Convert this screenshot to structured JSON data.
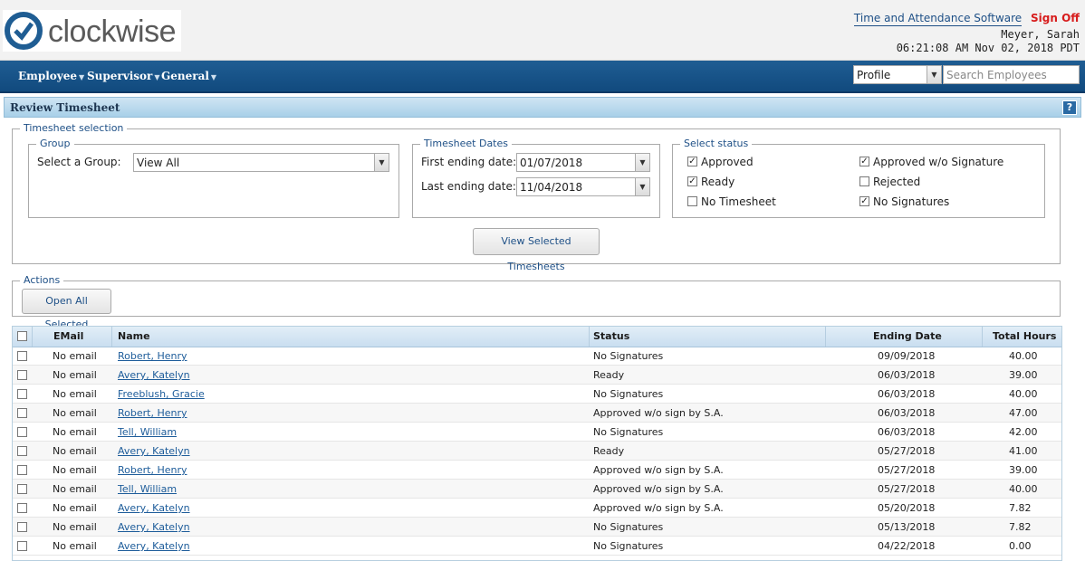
{
  "header": {
    "logo_text": "clockwise",
    "app_link": "Time and Attendance Software",
    "sign_off": "Sign Off",
    "user_name": "Meyer, Sarah",
    "clock": "06:21:08 AM Nov 02, 2018 PDT"
  },
  "nav": {
    "items": [
      "Employee",
      "Supervisor",
      "General"
    ],
    "profile_value": "Profile",
    "search_placeholder": "Search Employees"
  },
  "page": {
    "title": "Review Timesheet",
    "help": "?"
  },
  "selection": {
    "legend": "Timesheet selection",
    "group": {
      "legend": "Group",
      "label": "Select a Group:",
      "value": "View All"
    },
    "dates": {
      "legend": "Timesheet Dates",
      "first_label": "First ending date:",
      "first_value": "01/07/2018",
      "last_label": "Last ending date:",
      "last_value": "11/04/2018"
    },
    "status": {
      "legend": "Select status",
      "options": [
        {
          "label": "Approved",
          "checked": true
        },
        {
          "label": "Approved w/o Signature",
          "checked": true
        },
        {
          "label": "Ready",
          "checked": true
        },
        {
          "label": "Rejected",
          "checked": false
        },
        {
          "label": "No Timesheet",
          "checked": false
        },
        {
          "label": "No Signatures",
          "checked": true
        }
      ]
    },
    "view_button": "View Selected Timesheets"
  },
  "actions": {
    "legend": "Actions",
    "open_button": "Open All Selected"
  },
  "table": {
    "columns": [
      "EMail",
      "Name",
      "Status",
      "Ending Date",
      "Total Hours"
    ],
    "rows": [
      {
        "email": "No email",
        "name": "Robert, Henry",
        "status": "No Signatures",
        "date": "09/09/2018",
        "hours": "40.00"
      },
      {
        "email": "No email",
        "name": "Avery, Katelyn",
        "status": "Ready",
        "date": "06/03/2018",
        "hours": "39.00"
      },
      {
        "email": "No email",
        "name": "Freeblush, Gracie",
        "status": "No Signatures",
        "date": "06/03/2018",
        "hours": "40.00"
      },
      {
        "email": "No email",
        "name": "Robert, Henry",
        "status": "Approved w/o sign by S.A.",
        "date": "06/03/2018",
        "hours": "47.00"
      },
      {
        "email": "No email",
        "name": "Tell, William",
        "status": "No Signatures",
        "date": "06/03/2018",
        "hours": "42.00"
      },
      {
        "email": "No email",
        "name": "Avery, Katelyn",
        "status": "Ready",
        "date": "05/27/2018",
        "hours": "41.00"
      },
      {
        "email": "No email",
        "name": "Robert, Henry",
        "status": "Approved w/o sign by S.A.",
        "date": "05/27/2018",
        "hours": "39.00"
      },
      {
        "email": "No email",
        "name": "Tell, William",
        "status": "Approved w/o sign by S.A.",
        "date": "05/27/2018",
        "hours": "40.00"
      },
      {
        "email": "No email",
        "name": "Avery, Katelyn",
        "status": "Approved w/o sign by S.A.",
        "date": "05/20/2018",
        "hours": "7.82"
      },
      {
        "email": "No email",
        "name": "Avery, Katelyn",
        "status": "No Signatures",
        "date": "05/13/2018",
        "hours": "7.82"
      },
      {
        "email": "No email",
        "name": "Avery, Katelyn",
        "status": "No Signatures",
        "date": "04/22/2018",
        "hours": "0.00"
      }
    ]
  }
}
